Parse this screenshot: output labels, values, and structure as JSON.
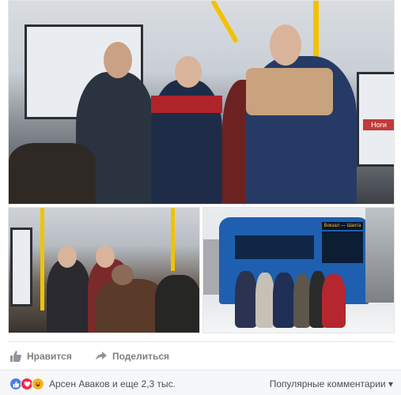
{
  "actions": {
    "like_label": "Нравится",
    "share_label": "Поделиться"
  },
  "reactions": {
    "summary": "Арсен Аваков и еще 2,3 тыс.",
    "sort_label": "Популярные комментарии ▾",
    "types": [
      "like",
      "love",
      "haha"
    ]
  },
  "photos": {
    "main_sign": "Ноги",
    "tram_sign": "Вокзал — Шахта"
  },
  "colors": {
    "like_blue": "#4b7be5",
    "love_red": "#f0284a",
    "haha_yellow": "#f7b125",
    "tram_blue": "#1f5fb0",
    "pole_yellow": "#f2c200"
  }
}
